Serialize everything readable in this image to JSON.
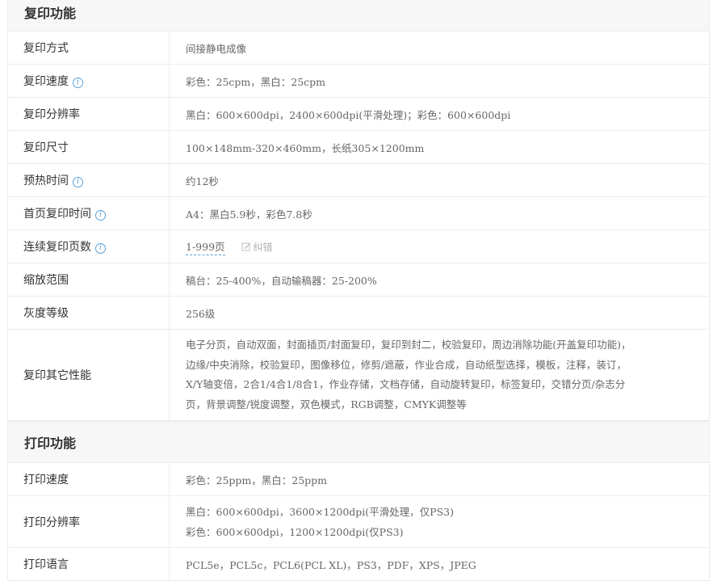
{
  "copy_section": {
    "title": "复印功能",
    "rows": [
      {
        "label": "复印方式",
        "value": "间接静电成像"
      },
      {
        "label": "复印速度",
        "value": "彩色：25cpm，黑白：25cpm"
      },
      {
        "label": "复印分辨率",
        "value": "黑白：600×600dpi，2400×600dpi(平滑处理)；彩色：600×600dpi"
      },
      {
        "label": "复印尺寸",
        "value": "100×148mm-320×460mm，长纸305×1200mm"
      },
      {
        "label": "预热时间",
        "value": "约12秒"
      },
      {
        "label": "首页复印时间",
        "value": "A4：黑白5.9秒，彩色7.8秒"
      },
      {
        "label": "连续复印页数",
        "value": "1-999页",
        "correction_label": "纠错"
      },
      {
        "label": "缩放范围",
        "value": "稿台：25-400%，自动输稿器：25-200%"
      },
      {
        "label": "灰度等级",
        "value": "256级"
      },
      {
        "label": "复印其它性能",
        "lines": [
          "电子分页，自动双面，封面插页/封面复印，复印到封二，校验复印，周边消除功能(开盖复印功能)，",
          "边缘/中央消除，校验复印，图像移位，修剪/遮蔽，作业合成，自动纸型选择，模板，注释，装订，",
          "X/Y轴变倍，2合1/4合1/8合1，作业存储，文档存储，自动旋转复印，标签复印，交错分页/杂志分",
          "页，背景调整/锐度调整，双色模式，RGB调整，CMYK调整等"
        ]
      }
    ]
  },
  "print_section": {
    "title": "打印功能",
    "rows": [
      {
        "label": "打印速度",
        "value": "彩色：25ppm，黑白：25ppm"
      },
      {
        "label": "打印分辨率",
        "lines": [
          "黑白：600×600dpi，3600×1200dpi(平滑处理，仅PS3)",
          "彩色：600×600dpi，1200×1200dpi(仅PS3)"
        ]
      },
      {
        "label": "打印语言",
        "value": "PCL5e，PCL5c，PCL6(PCL XL)，PS3，PDF，XPS，JPEG"
      }
    ]
  },
  "icons": {
    "info": "info-icon",
    "edit": "pencil-icon"
  },
  "colors": {
    "accent": "#5aa0d8",
    "header_bg": "#f7f7f7",
    "border": "#ececec"
  }
}
